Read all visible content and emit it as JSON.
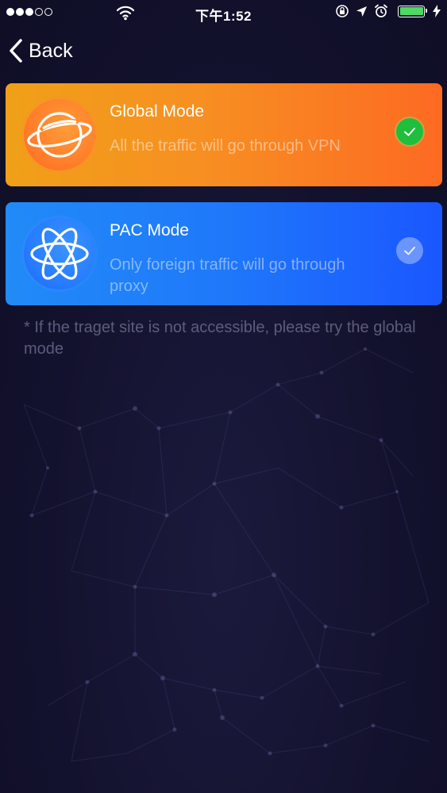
{
  "status_bar": {
    "time": "下午1:52",
    "signal_bars_filled": 3,
    "signal_bars_total": 5,
    "battery_color": "#4cd964",
    "icons": [
      "wifi-icon",
      "rotation-lock-icon",
      "location-icon",
      "alarm-icon",
      "battery-icon",
      "charging-bolt-icon"
    ]
  },
  "nav": {
    "back_label": "Back",
    "back_icon": "chevron-left-icon"
  },
  "modes": [
    {
      "id": "global",
      "title": "Global Mode",
      "subtitle": "All the traffic will go through VPN",
      "icon": "planet-icon",
      "selected": true,
      "colors": [
        "#f0a018",
        "#fd6a22"
      ]
    },
    {
      "id": "pac",
      "title": "PAC Mode",
      "subtitle": "Only foreign traffic will go through proxy",
      "icon": "atom-icon",
      "selected": false,
      "colors": [
        "#218bf7",
        "#1a57ff"
      ]
    }
  ],
  "note": "* If the traget site is not accessible, please try the global mode",
  "colors": {
    "background": "#13122e",
    "check_active": "#1fbe3c"
  }
}
